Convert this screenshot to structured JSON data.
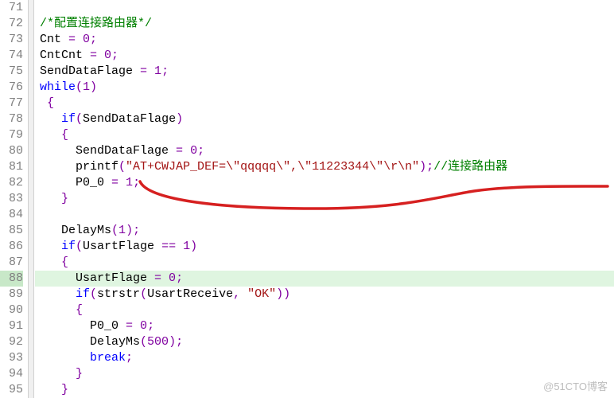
{
  "lineNumbers": [
    "71",
    "72",
    "73",
    "74",
    "75",
    "76",
    "77",
    "78",
    "79",
    "80",
    "81",
    "82",
    "83",
    "84",
    "85",
    "86",
    "87",
    "88",
    "89",
    "90",
    "91",
    "92",
    "93",
    "94",
    "95"
  ],
  "highlightedLine": "88",
  "code": {
    "l72": {
      "comment": "/*配置连接路由器*/"
    },
    "l73": {
      "ident": "Cnt",
      "eq": " = ",
      "num": "0",
      "semi": ";"
    },
    "l74": {
      "ident": "CntCnt",
      "eq": " = ",
      "num": "0",
      "semi": ";"
    },
    "l75": {
      "ident": "SendDataFlage",
      "eq": " = ",
      "num": "1",
      "semi": ";"
    },
    "l76": {
      "kw": "while",
      "lp": "(",
      "num": "1",
      "rp": ")"
    },
    "l77": {
      "brace": "{"
    },
    "l78": {
      "kw": "if",
      "lp": "(",
      "ident": "SendDataFlage",
      "rp": ")"
    },
    "l79": {
      "brace": "{"
    },
    "l80": {
      "ident": "SendDataFlage",
      "eq": " = ",
      "num": "0",
      "semi": ";"
    },
    "l81": {
      "ident": "printf",
      "lp": "(",
      "str": "\"AT+CWJAP_DEF=\\\"qqqqq\\\",\\\"11223344\\\"\\r\\n\"",
      "rp": ")",
      "semi": ";",
      "comment": "//连接路由器"
    },
    "l82": {
      "ident": "P0_0",
      "eq": " = ",
      "num": "1",
      "semi": ";"
    },
    "l83": {
      "brace": "}"
    },
    "l85": {
      "ident": "DelayMs",
      "lp": "(",
      "num": "1",
      "rp": ")",
      "semi": ";"
    },
    "l86": {
      "kw": "if",
      "lp": "(",
      "ident": "UsartFlage",
      "eq2": " == ",
      "num": "1",
      "rp": ")"
    },
    "l87": {
      "brace": "{"
    },
    "l88": {
      "ident": "UsartFlage",
      "eq": " = ",
      "num": "0",
      "semi": ";"
    },
    "l89": {
      "kw": "if",
      "lp": "(",
      "ident": "strstr",
      "lp2": "(",
      "arg1": "UsartReceive",
      "comma": ", ",
      "str": "\"OK\"",
      "rp2": ")",
      "rp": ")"
    },
    "l90": {
      "brace": "{"
    },
    "l91": {
      "ident": "P0_0",
      "eq": " = ",
      "num": "0",
      "semi": ";"
    },
    "l92": {
      "ident": "DelayMs",
      "lp": "(",
      "num": "500",
      "rp": ")",
      "semi": ";"
    },
    "l93": {
      "kw": "break",
      "semi": ";"
    },
    "l94": {
      "brace": "}"
    },
    "l95": {
      "brace": "}"
    }
  },
  "watermark": "@51CTO博客"
}
